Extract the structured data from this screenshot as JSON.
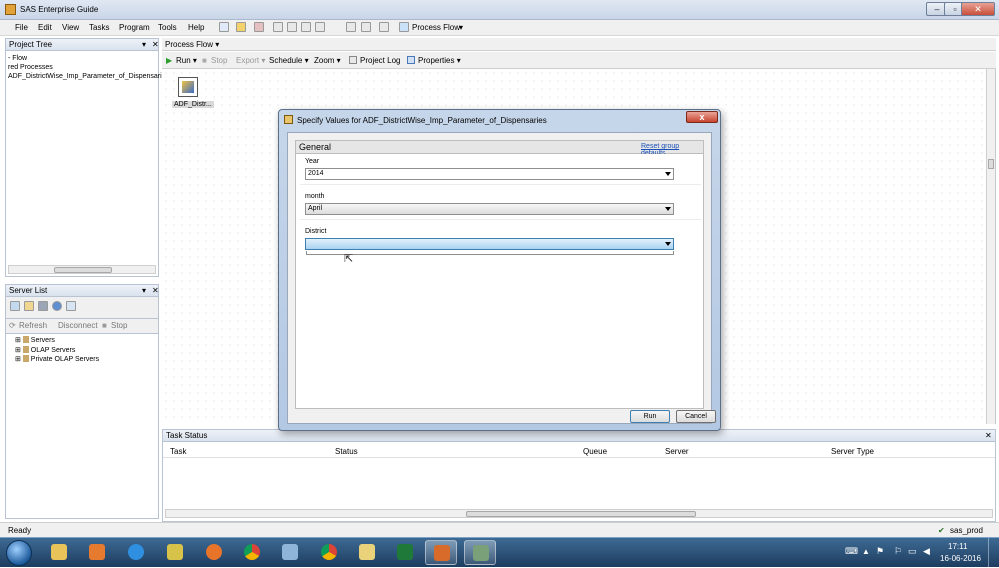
{
  "window": {
    "title": "SAS Enterprise Guide"
  },
  "menu": {
    "items": [
      "File",
      "Edit",
      "View",
      "Tasks",
      "Program",
      "Tools",
      "Help"
    ],
    "process_flow": "Process Flow"
  },
  "project_tree": {
    "title": "Project Tree",
    "items": [
      "- Flow",
      "red Processes",
      "ADF_DistrictWise_Imp_Parameter_of_Dispensaries"
    ]
  },
  "server_list": {
    "title": "Server List",
    "actions": {
      "refresh": "Refresh",
      "disconnect": "Disconnect",
      "stop": "Stop"
    },
    "items": [
      "Servers",
      "OLAP Servers",
      "Private OLAP Servers"
    ]
  },
  "process_flow": {
    "tab": "Process Flow",
    "toolbar": {
      "run": "Run",
      "stop": "Stop",
      "export": "Export",
      "schedule": "Schedule",
      "zoom": "Zoom",
      "project_log": "Project Log",
      "properties": "Properties"
    },
    "node_label": "ADF_Distr..."
  },
  "dialog": {
    "title": "Specify Values for ADF_DistrictWise_Imp_Parameter_of_Dispensaries",
    "close_glyph": "x",
    "group": "General",
    "reset_link": "Reset group defaults",
    "fields": [
      {
        "label": "Year",
        "value": "2014"
      },
      {
        "label": "month",
        "value": "April"
      },
      {
        "label": "District",
        "value": ""
      }
    ],
    "run": "Run",
    "cancel": "Cancel"
  },
  "task_status": {
    "title": "Task Status",
    "columns": [
      "Task",
      "Status",
      "Queue",
      "Server",
      "Server Type"
    ]
  },
  "statusbar": {
    "text": "Ready",
    "server": "sas_prod"
  },
  "taskbar": {
    "time": "17:11",
    "date": "16-06-2016"
  },
  "colors": {
    "accent": "#3399ff",
    "taskbar": "#2a4f76"
  }
}
